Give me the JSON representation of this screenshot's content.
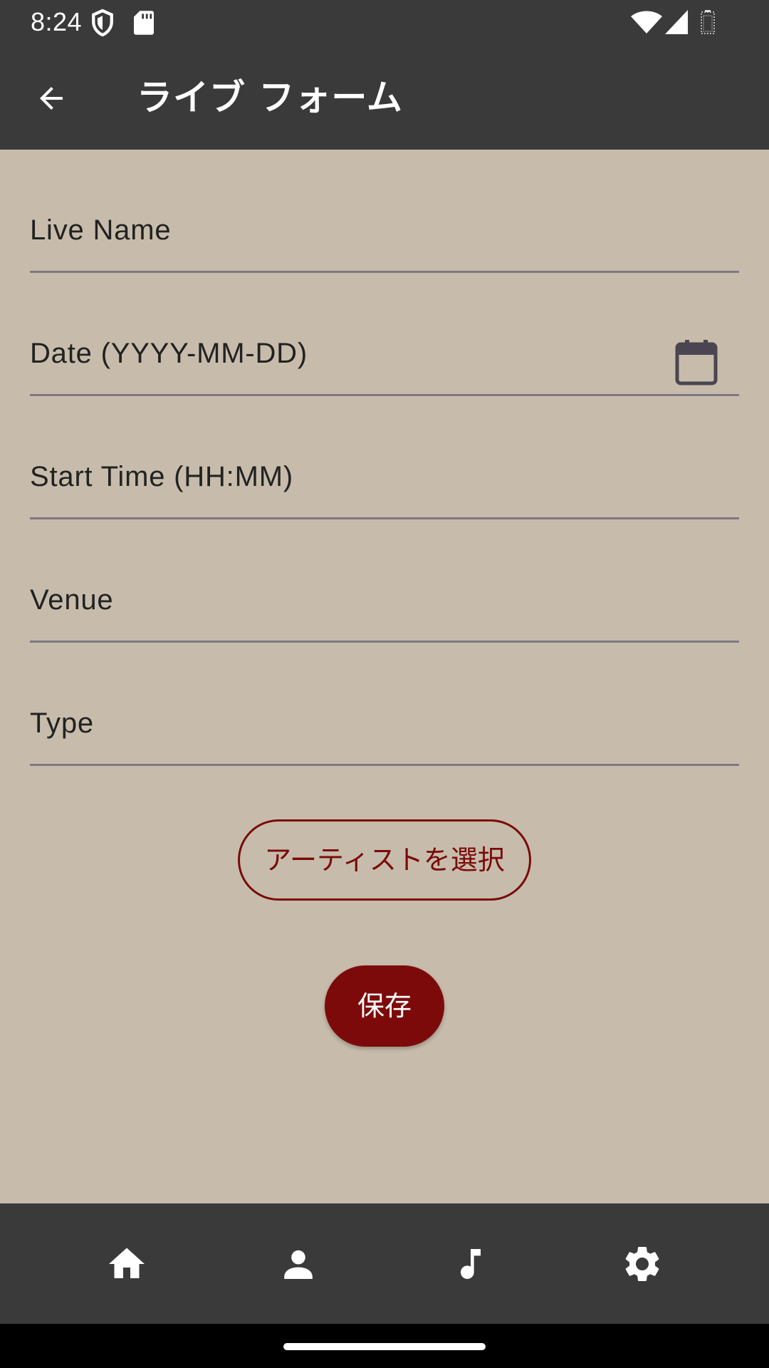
{
  "status_bar": {
    "time": "8:24",
    "icons": [
      "shield-icon",
      "sd-card-icon",
      "wifi-icon",
      "cell-signal-icon",
      "battery-icon"
    ]
  },
  "app_bar": {
    "back_icon": "arrow-back-icon",
    "title": "ライブ フォーム"
  },
  "form": {
    "fields": [
      {
        "label": "Live Name",
        "value": ""
      },
      {
        "label": "Date (YYYY-MM-DD)",
        "value": "",
        "icon": "calendar-icon"
      },
      {
        "label": "Start Time (HH:MM)",
        "value": ""
      },
      {
        "label": "Venue",
        "value": ""
      },
      {
        "label": "Type",
        "value": ""
      }
    ],
    "select_artist_label": "アーティストを選択",
    "save_label": "保存"
  },
  "bottom_nav": {
    "items": [
      "home-icon",
      "person-icon",
      "music-note-icon",
      "settings-icon"
    ]
  },
  "colors": {
    "bar_background": "#3a3a3a",
    "page_background": "#c7bcab",
    "accent": "#7d0a0a",
    "field_underline": "#7d7882"
  }
}
